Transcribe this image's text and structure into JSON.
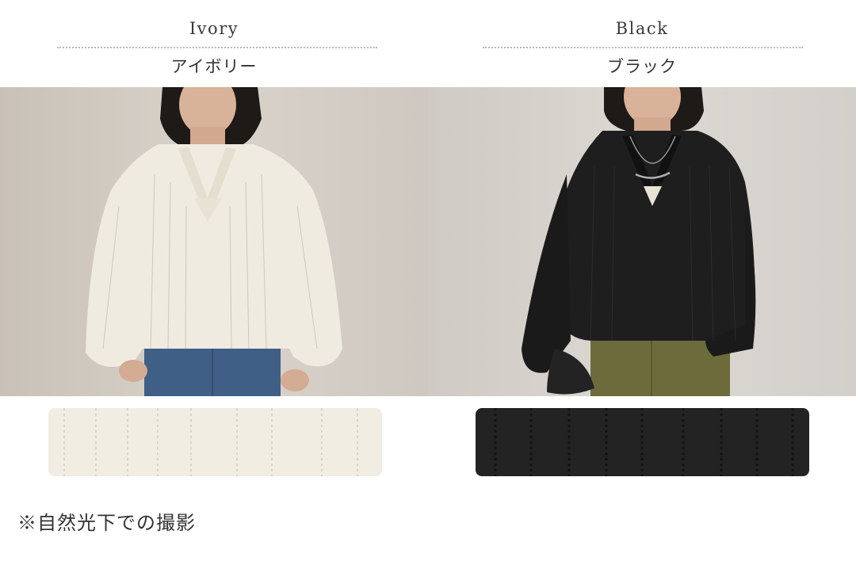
{
  "colors": [
    {
      "name_en": "Ivory",
      "name_jp": "アイボリー",
      "background_color": "#d6d0c8",
      "garment_color": "#efebe1",
      "bottoms": "denim",
      "bottoms_color": "#3f5f86",
      "swatch_color": "#f1ede3",
      "swatch_line_color": "#d9d3c6"
    },
    {
      "name_en": "Black",
      "name_jp": "ブラック",
      "background_color": "#d8d4cf",
      "garment_color": "#1e1e1e",
      "bottoms": "khaki",
      "bottoms_color": "#6d6b3c",
      "swatch_color": "#232323",
      "swatch_line_color": "#121212"
    }
  ],
  "note": "※自然光下での撮影"
}
